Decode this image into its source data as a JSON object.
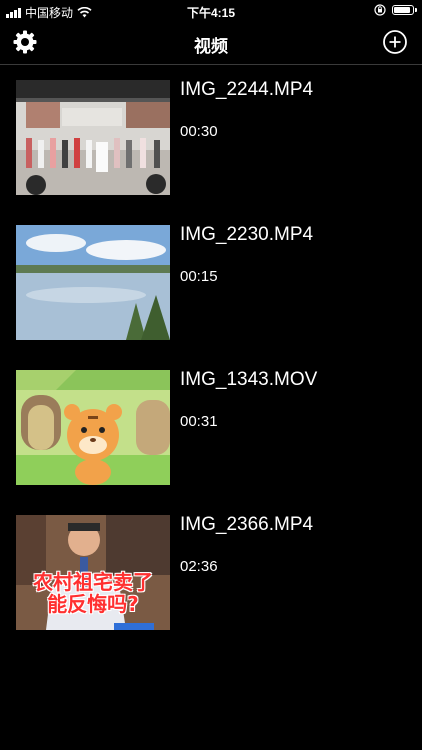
{
  "status_bar": {
    "carrier": "中国移动",
    "time": "下午4:15",
    "wifi_icon": "wifi-icon",
    "lock_icon": "orientation-lock-icon",
    "battery_icon": "battery-icon",
    "battery_level": 0.9
  },
  "nav": {
    "title": "视频",
    "settings_icon": "gear-icon",
    "add_icon": "add-circle-icon"
  },
  "videos": [
    {
      "name": "IMG_2244.MP4",
      "duration": "00:30"
    },
    {
      "name": "IMG_2230.MP4",
      "duration": "00:15"
    },
    {
      "name": "IMG_1343.MOV",
      "duration": "00:31"
    },
    {
      "name": "IMG_2366.MP4",
      "duration": "02:36",
      "thumbnail_caption_line1": "农村祖宅卖了",
      "thumbnail_caption_line2": "能反悔吗?"
    }
  ],
  "colors": {
    "background": "#000000",
    "text": "#ffffff",
    "divider": "#3a3a3a"
  }
}
